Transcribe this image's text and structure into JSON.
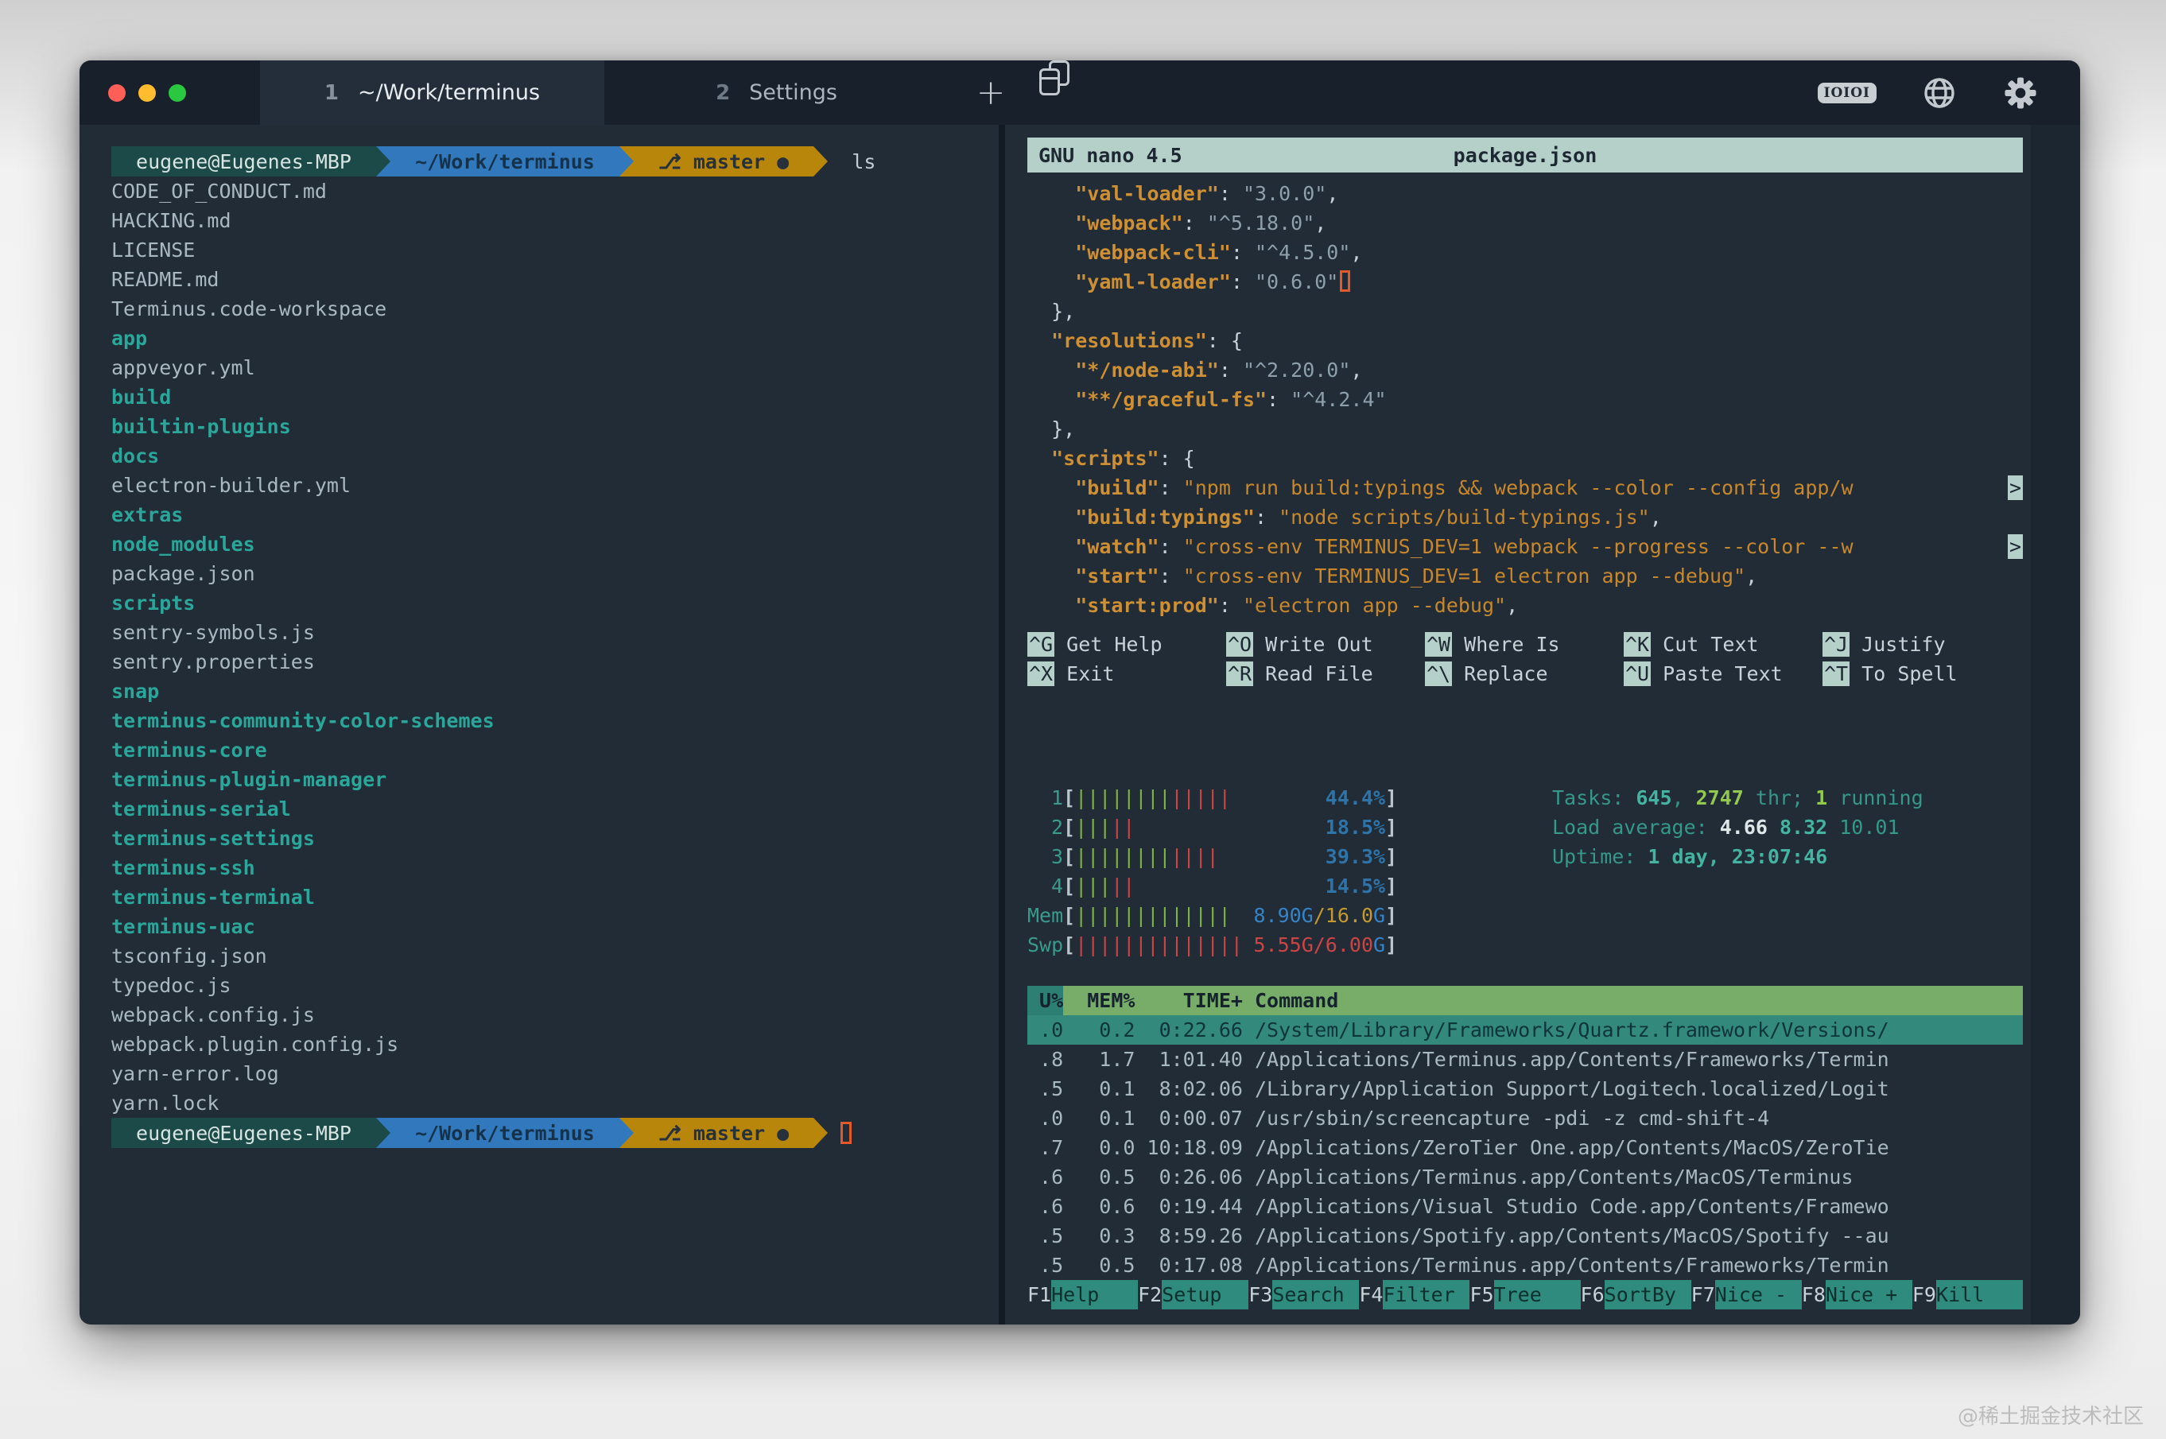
{
  "window": {
    "traffic_lights": {
      "close": "#ff5f57",
      "minimize": "#febc2e",
      "zoom": "#2ac840"
    },
    "tabs": [
      {
        "number": "1",
        "title": "~/Work/terminus",
        "active": true
      },
      {
        "number": "2",
        "title": "Settings",
        "active": false
      }
    ],
    "toolbar": {
      "new_tab_label": "+",
      "serial_badge": "IOIOI"
    }
  },
  "colors": {
    "terminal_bg": "#212c37",
    "titlebar_bg": "#18212b",
    "accent_teal": "#2aa79a",
    "prompt_user_bg": "#1b4a49",
    "prompt_dir_bg": "#3178bd",
    "prompt_git_bg": "#b8860b",
    "nano_bar_bg": "#b5cfc9",
    "amber": "#cf8f33",
    "htop_header_green": "#77ad68",
    "htop_select_teal": "#33897c",
    "cursor_orange": "#e3592a"
  },
  "left_terminal": {
    "prompt": {
      "user": "eugene@Eugenes-MBP",
      "dir": "~/Work/terminus",
      "branch_icon": "⎇",
      "branch": "master",
      "dirty_dot": "●",
      "command": "ls"
    },
    "files": [
      {
        "n": "CODE_OF_CONDUCT.md",
        "d": false
      },
      {
        "n": "HACKING.md",
        "d": false
      },
      {
        "n": "LICENSE",
        "d": false
      },
      {
        "n": "README.md",
        "d": false
      },
      {
        "n": "Terminus.code-workspace",
        "d": false
      },
      {
        "n": "app",
        "d": true
      },
      {
        "n": "appveyor.yml",
        "d": false
      },
      {
        "n": "build",
        "d": true
      },
      {
        "n": "builtin-plugins",
        "d": true
      },
      {
        "n": "docs",
        "d": true
      },
      {
        "n": "electron-builder.yml",
        "d": false
      },
      {
        "n": "extras",
        "d": true
      },
      {
        "n": "node_modules",
        "d": true
      },
      {
        "n": "package.json",
        "d": false
      },
      {
        "n": "scripts",
        "d": true
      },
      {
        "n": "sentry-symbols.js",
        "d": false
      },
      {
        "n": "sentry.properties",
        "d": false
      },
      {
        "n": "snap",
        "d": true
      },
      {
        "n": "terminus-community-color-schemes",
        "d": true
      },
      {
        "n": "terminus-core",
        "d": true
      },
      {
        "n": "terminus-plugin-manager",
        "d": true
      },
      {
        "n": "terminus-serial",
        "d": true
      },
      {
        "n": "terminus-settings",
        "d": true
      },
      {
        "n": "terminus-ssh",
        "d": true
      },
      {
        "n": "terminus-terminal",
        "d": true
      },
      {
        "n": "terminus-uac",
        "d": true
      },
      {
        "n": "tsconfig.json",
        "d": false
      },
      {
        "n": "typedoc.js",
        "d": false
      },
      {
        "n": "webpack.config.js",
        "d": false
      },
      {
        "n": "webpack.plugin.config.js",
        "d": false
      },
      {
        "n": "yarn-error.log",
        "d": false
      },
      {
        "n": "yarn.lock",
        "d": false
      }
    ]
  },
  "nano": {
    "title_left": "GNU nano 4.5",
    "title_file": "package.json",
    "lines": [
      [
        [
          "p",
          "    "
        ],
        [
          "k",
          "\"val-loader\""
        ],
        [
          "p",
          ": "
        ],
        [
          "s",
          "\"3.0.0\""
        ],
        [
          "p",
          ","
        ]
      ],
      [
        [
          "p",
          "    "
        ],
        [
          "k",
          "\"webpack\""
        ],
        [
          "p",
          ": "
        ],
        [
          "s",
          "\"^5.18.0\""
        ],
        [
          "p",
          ","
        ]
      ],
      [
        [
          "p",
          "    "
        ],
        [
          "k",
          "\"webpack-cli\""
        ],
        [
          "p",
          ": "
        ],
        [
          "s",
          "\"^4.5.0\""
        ],
        [
          "p",
          ","
        ]
      ],
      [
        [
          "p",
          "    "
        ],
        [
          "k",
          "\"yaml-loader\""
        ],
        [
          "p",
          ": "
        ],
        [
          "s",
          "\"0.6.0\""
        ],
        [
          "cursor",
          ""
        ]
      ],
      [
        [
          "p",
          "  },"
        ]
      ],
      [
        [
          "p",
          "  "
        ],
        [
          "k",
          "\"resolutions\""
        ],
        [
          "p",
          ": {"
        ]
      ],
      [
        [
          "p",
          "    "
        ],
        [
          "k",
          "\"*/node-abi\""
        ],
        [
          "p",
          ": "
        ],
        [
          "s",
          "\"^2.20.0\""
        ],
        [
          "p",
          ","
        ]
      ],
      [
        [
          "p",
          "    "
        ],
        [
          "k",
          "\"**/graceful-fs\""
        ],
        [
          "p",
          ": "
        ],
        [
          "s",
          "\"^4.2.4\""
        ]
      ],
      [
        [
          "p",
          "  },"
        ]
      ],
      [
        [
          "p",
          "  "
        ],
        [
          "k",
          "\"scripts\""
        ],
        [
          "p",
          ": {"
        ]
      ],
      [
        [
          "p",
          "    "
        ],
        [
          "k",
          "\"build\""
        ],
        [
          "p",
          ": "
        ],
        [
          "v",
          "\"npm run build:typings && webpack --color --config app/w"
        ],
        [
          "cont",
          ">"
        ]
      ],
      [
        [
          "p",
          "    "
        ],
        [
          "k",
          "\"build:typings\""
        ],
        [
          "p",
          ": "
        ],
        [
          "v",
          "\"node scripts/build-typings.js\""
        ],
        [
          "p",
          ","
        ]
      ],
      [
        [
          "p",
          "    "
        ],
        [
          "k",
          "\"watch\""
        ],
        [
          "p",
          ": "
        ],
        [
          "v",
          "\"cross-env TERMINUS_DEV=1 webpack --progress --color --w"
        ],
        [
          "cont",
          ">"
        ]
      ],
      [
        [
          "p",
          "    "
        ],
        [
          "k",
          "\"start\""
        ],
        [
          "p",
          ": "
        ],
        [
          "v",
          "\"cross-env TERMINUS_DEV=1 electron app --debug\""
        ],
        [
          "p",
          ","
        ]
      ],
      [
        [
          "p",
          "    "
        ],
        [
          "k",
          "\"start:prod\""
        ],
        [
          "p",
          ": "
        ],
        [
          "v",
          "\"electron app --debug\""
        ],
        [
          "p",
          ","
        ]
      ]
    ],
    "shortcuts": [
      [
        {
          "key": "^G",
          "label": "Get Help"
        },
        {
          "key": "^X",
          "label": "Exit"
        }
      ],
      [
        {
          "key": "^O",
          "label": "Write Out"
        },
        {
          "key": "^R",
          "label": "Read File"
        }
      ],
      [
        {
          "key": "^W",
          "label": "Where Is"
        },
        {
          "key": "^\\",
          "label": "Replace"
        }
      ],
      [
        {
          "key": "^K",
          "label": "Cut Text"
        },
        {
          "key": "^U",
          "label": "Paste Text"
        }
      ],
      [
        {
          "key": "^J",
          "label": "Justify"
        },
        {
          "key": "^T",
          "label": "To Spell"
        }
      ]
    ]
  },
  "htop": {
    "meters": [
      {
        "label": "1",
        "pipes": [
          [
            "pg",
            8
          ],
          [
            "pr",
            5
          ]
        ],
        "text": [
          [
            "c-pct",
            "44.4%"
          ]
        ]
      },
      {
        "label": "2",
        "pipes": [
          [
            "pg",
            3
          ],
          [
            "pr",
            2
          ]
        ],
        "text": [
          [
            "c-pct",
            "18.5%"
          ]
        ]
      },
      {
        "label": "3",
        "pipes": [
          [
            "pg",
            8
          ],
          [
            "pr",
            4
          ]
        ],
        "text": [
          [
            "c-pct",
            "39.3%"
          ]
        ]
      },
      {
        "label": "4",
        "pipes": [
          [
            "pg",
            3
          ],
          [
            "pr",
            2
          ]
        ],
        "text": [
          [
            "c-pct",
            "14.5%"
          ]
        ]
      },
      {
        "label": "Mem",
        "pipes": [
          [
            "pg",
            13
          ]
        ],
        "text": [
          [
            "c-blue",
            "8.90G"
          ],
          [
            "c-amb",
            "/16.0"
          ],
          [
            "c-blue",
            "G"
          ]
        ]
      },
      {
        "label": "Swp",
        "pipes": [
          [
            "pr",
            14
          ]
        ],
        "text": [
          [
            "c-red",
            "5.55G/6.00"
          ],
          [
            "c-blue",
            "G"
          ]
        ]
      }
    ],
    "info": [
      [
        [
          "c-teal",
          "Tasks: "
        ],
        [
          "c-tealb",
          "645"
        ],
        [
          "c-teal",
          ", "
        ],
        [
          "c-greenb",
          "2747"
        ],
        [
          "c-teal",
          " thr; "
        ],
        [
          "c-greenb",
          "1"
        ],
        [
          "c-teal",
          " running"
        ]
      ],
      [
        [
          "c-teal",
          "Load average: "
        ],
        [
          "c-whiteb",
          "4.66 "
        ],
        [
          "c-tealb",
          "8.32 "
        ],
        [
          "c-teal",
          "10.01"
        ]
      ],
      [
        [
          "c-teal",
          "Uptime: "
        ],
        [
          "c-tealb",
          "1 day, 23:07:46"
        ]
      ]
    ],
    "table": {
      "header": {
        "cpu": "U%",
        "mem": "MEM%",
        "time": "TIME+",
        "cmd": "Command"
      },
      "rows": [
        {
          "cpu": ".0",
          "mem": "0.2",
          "time": "0:22.66",
          "cmd": "/System/Library/Frameworks/Quartz.framework/Versions/",
          "selected": true
        },
        {
          "cpu": ".8",
          "mem": "1.7",
          "time": "1:01.40",
          "cmd": "/Applications/Terminus.app/Contents/Frameworks/Termin",
          "selected": false
        },
        {
          "cpu": ".5",
          "mem": "0.1",
          "time": "8:02.06",
          "cmd": "/Library/Application Support/Logitech.localized/Logit",
          "selected": false
        },
        {
          "cpu": ".0",
          "mem": "0.1",
          "time": "0:00.07",
          "cmd": "/usr/sbin/screencapture -pdi -z cmd-shift-4",
          "selected": false
        },
        {
          "cpu": ".7",
          "mem": "0.0",
          "time": "10:18.09",
          "cmd": "/Applications/ZeroTier One.app/Contents/MacOS/ZeroTie",
          "selected": false
        },
        {
          "cpu": ".6",
          "mem": "0.5",
          "time": "0:26.06",
          "cmd": "/Applications/Terminus.app/Contents/MacOS/Terminus",
          "selected": false
        },
        {
          "cpu": ".6",
          "mem": "0.6",
          "time": "0:19.44",
          "cmd": "/Applications/Visual Studio Code.app/Contents/Framewo",
          "selected": false
        },
        {
          "cpu": ".5",
          "mem": "0.3",
          "time": "8:59.26",
          "cmd": "/Applications/Spotify.app/Contents/MacOS/Spotify --au",
          "selected": false
        },
        {
          "cpu": ".5",
          "mem": "0.5",
          "time": "0:17.08",
          "cmd": "/Applications/Terminus.app/Contents/Frameworks/Termin",
          "selected": false
        }
      ]
    },
    "fkeys": [
      {
        "k": "F1",
        "label": "Help"
      },
      {
        "k": "F2",
        "label": "Setup"
      },
      {
        "k": "F3",
        "label": "Search"
      },
      {
        "k": "F4",
        "label": "Filter"
      },
      {
        "k": "F5",
        "label": "Tree"
      },
      {
        "k": "F6",
        "label": "SortBy"
      },
      {
        "k": "F7",
        "label": "Nice -"
      },
      {
        "k": "F8",
        "label": "Nice +"
      },
      {
        "k": "F9",
        "label": "Kill"
      }
    ]
  },
  "watermark": "@稀土掘金技术社区"
}
